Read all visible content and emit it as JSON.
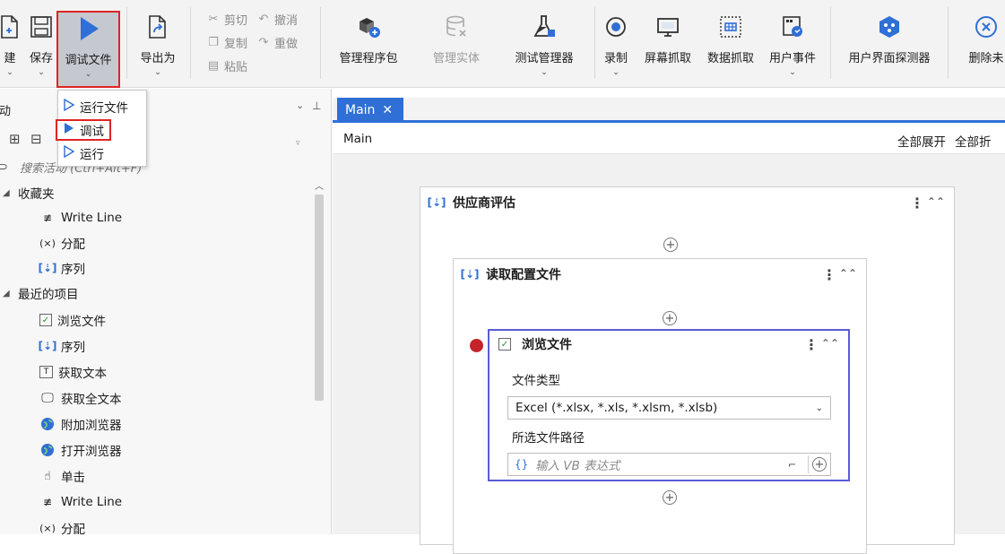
{
  "ribbon": {
    "new_label": "建",
    "save_label": "保存",
    "debug_label": "调试文件",
    "export_label": "导出为",
    "cut_label": "剪切",
    "undo_label": "撤消",
    "copy_label": "复制",
    "redo_label": "重做",
    "paste_label": "粘贴",
    "manage_packages_label": "管理程序包",
    "manage_entities_label": "管理实体",
    "test_manager_label": "测试管理器",
    "record_label": "录制",
    "screen_scraping_label": "屏幕抓取",
    "data_scraping_label": "数据抓取",
    "user_events_label": "用户事件",
    "ui_explorer_label": "用户界面探测器",
    "remove_unused_label": "删除未"
  },
  "debug_dropdown": {
    "items": [
      "运行文件",
      "调试",
      "运行"
    ],
    "selected": "调试"
  },
  "activities_panel": {
    "title": "活动",
    "search_placeholder": "搜索活动 (Ctrl+Alt+F)",
    "sections": [
      {
        "name": "收藏夹",
        "items": [
          {
            "label": "Write Line",
            "icon": "pen-icon"
          },
          {
            "label": "分配",
            "icon": "assign-icon"
          },
          {
            "label": "序列",
            "icon": "sequence-icon"
          }
        ]
      },
      {
        "name": "最近的项目",
        "items": [
          {
            "label": "浏览文件",
            "icon": "checkbox-icon"
          },
          {
            "label": "序列",
            "icon": "sequence-icon"
          },
          {
            "label": "获取文本",
            "icon": "get-text-icon"
          },
          {
            "label": "获取全文本",
            "icon": "monitor-icon"
          },
          {
            "label": "附加浏览器",
            "icon": "globe-icon"
          },
          {
            "label": "打开浏览器",
            "icon": "globe-icon"
          },
          {
            "label": "单击",
            "icon": "click-icon"
          },
          {
            "label": "Write Line",
            "icon": "pen-icon"
          },
          {
            "label": "分配",
            "icon": "assign-icon"
          }
        ]
      }
    ]
  },
  "designer": {
    "tab_label": "Main",
    "breadcrumb": "Main",
    "expand_all": "全部展开",
    "collapse_all": "全部折",
    "outer_sequence": "供应商评估",
    "inner_sequence": "读取配置文件",
    "activity": {
      "title": "浏览文件",
      "file_type_label": "文件类型",
      "file_type_value": "Excel (*.xlsx, *.xls, *.xlsm, *.xlsb)",
      "path_label": "所选文件路径",
      "path_placeholder": "输入 VB 表达式",
      "expr_prefix": "{}"
    }
  },
  "colors": {
    "accent_blue": "#2f6fd6",
    "highlight_red": "#e02424",
    "breakpoint_red": "#c4232a",
    "selection_purple": "#5b5bd6"
  }
}
